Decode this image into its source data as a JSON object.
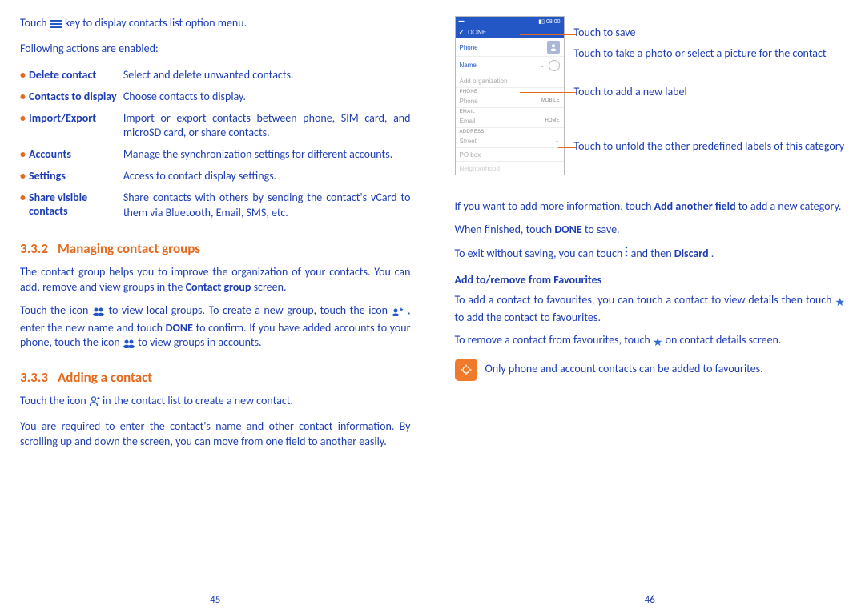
{
  "left": {
    "intro_pre": "Touch ",
    "intro_post": " key to display contacts list option menu.",
    "following": "Following actions are enabled:",
    "menu": [
      {
        "label": "Delete contact",
        "desc": "Select and delete unwanted contacts."
      },
      {
        "label": "Contacts to display",
        "desc": "Choose contacts to display."
      },
      {
        "label": "Import/Export",
        "desc": "Import or export contacts between phone, SIM card, and microSD card, or share contacts."
      },
      {
        "label": "Accounts",
        "desc": "Manage the synchronization settings for different accounts."
      },
      {
        "label": "Settings",
        "desc": "Access to contact display settings."
      },
      {
        "label": "Share visible contacts",
        "desc": "Share contacts with others by sending the contact's vCard to them via Bluetooth, Email, SMS, etc."
      }
    ],
    "h332_num": "3.3.2",
    "h332_title": "Managing contact groups",
    "groups_p1": "The contact group helps you to improve the organization of your contacts. You can add, remove and view groups in the ",
    "groups_p1_bold": "Contact group",
    "groups_p1_after": " screen.",
    "groups_p2a": "Touch the icon ",
    "groups_p2b": " to view local groups. To create a new group, touch the icon ",
    "groups_p2c": " , enter the new name and touch ",
    "groups_p2_bold": "DONE",
    "groups_p2d": " to confirm. If you have added accounts to your phone, touch the icon ",
    "groups_p2e": " to view groups in accounts.",
    "h333_num": "3.3.3",
    "h333_title": "Adding a contact",
    "add_p1a": "Touch the icon ",
    "add_p1b": " in the contact list to create a new contact.",
    "add_p2": "You are required to enter the contact's name and other contact information. By scrolling up and down the screen, you can move from one field to another easily.",
    "pagenum": "45"
  },
  "right": {
    "phone": {
      "time": "08:00",
      "done": "DONE",
      "row_phone_top": "Phone",
      "name_placeholder": "Name",
      "add_org": "Add organization",
      "section_phone": "PHONE",
      "field_phone": "Phone",
      "label_mobile": "MOBILE",
      "section_email": "EMAIL",
      "field_email": "Email",
      "label_home": "HOME",
      "section_address": "ADDRESS",
      "field_street": "Street",
      "field_pobox": "PO box",
      "field_neigh": "Neighborhood"
    },
    "callouts": {
      "save": "Touch to save",
      "photo": "Touch to take a photo or select a picture for the contact",
      "label": "Touch to add a new label",
      "unfold": "Touch to unfold the other predefined labels of this category"
    },
    "p_addfield_a": "If you want to add more information, touch ",
    "p_addfield_b": "Add another field",
    "p_addfield_c": " to add a new category.",
    "p_done_a": "When finished, touch ",
    "p_done_b": "DONE",
    "p_done_c": " to save.",
    "p_discard_a": "To exit without saving, you can touch ",
    "p_discard_b": " and then ",
    "p_discard_c": "Discard",
    "p_discard_d": ".",
    "h_fav": "Add to/remove from Favourites",
    "fav_p1a": "To add a contact to favourites, you can touch a contact to view details then touch ",
    "fav_p1b": " to add the contact to favourites.",
    "fav_p2a": "To remove a contact from favourites, touch ",
    "fav_p2b": " on contact details screen.",
    "tip": "Only phone and account contacts can be added to favourites.",
    "pagenum": "46"
  }
}
